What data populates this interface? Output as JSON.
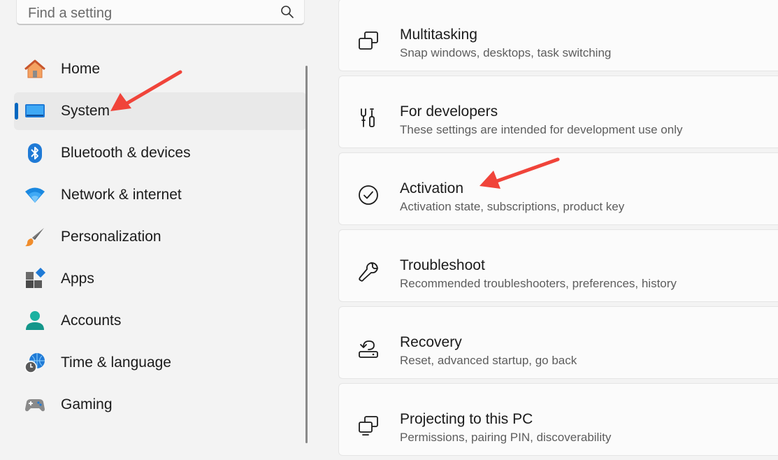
{
  "search": {
    "placeholder": "Find a setting",
    "icon": "search-icon"
  },
  "sidebar": {
    "selected": "System",
    "accent_color": "#0067c0",
    "items": [
      {
        "label": "Home",
        "icon": "home-icon"
      },
      {
        "label": "System",
        "icon": "system-icon"
      },
      {
        "label": "Bluetooth & devices",
        "icon": "bluetooth-icon"
      },
      {
        "label": "Network & internet",
        "icon": "network-icon"
      },
      {
        "label": "Personalization",
        "icon": "personalization-icon"
      },
      {
        "label": "Apps",
        "icon": "apps-icon"
      },
      {
        "label": "Accounts",
        "icon": "accounts-icon"
      },
      {
        "label": "Time & language",
        "icon": "time-language-icon"
      },
      {
        "label": "Gaming",
        "icon": "gaming-icon"
      }
    ]
  },
  "cards": [
    {
      "title": "Multitasking",
      "subtitle": "Snap windows, desktops, task switching",
      "icon": "multitasking-icon"
    },
    {
      "title": "For developers",
      "subtitle": "These settings are intended for development use only",
      "icon": "developers-icon"
    },
    {
      "title": "Activation",
      "subtitle": "Activation state, subscriptions, product key",
      "icon": "activation-icon"
    },
    {
      "title": "Troubleshoot",
      "subtitle": "Recommended troubleshooters, preferences, history",
      "icon": "troubleshoot-icon"
    },
    {
      "title": "Recovery",
      "subtitle": "Reset, advanced startup, go back",
      "icon": "recovery-icon"
    },
    {
      "title": "Projecting to this PC",
      "subtitle": "Permissions, pairing PIN, discoverability",
      "icon": "projecting-icon"
    }
  ],
  "annotations": {
    "arrow_color": "#f0443a"
  }
}
